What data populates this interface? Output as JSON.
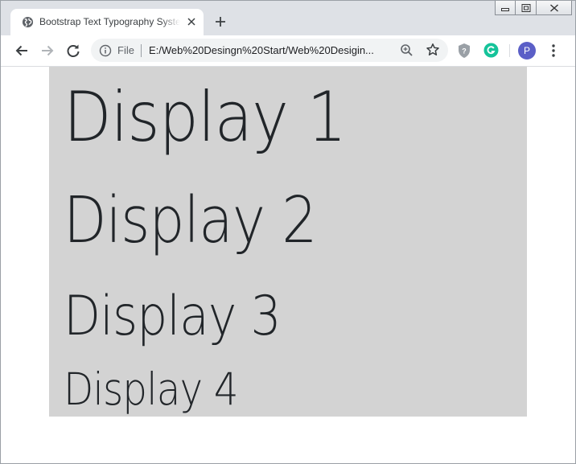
{
  "browser": {
    "tab": {
      "title": "Bootstrap Text Typography System",
      "favicon": "globe-icon"
    },
    "address_bar": {
      "scheme_label": "File",
      "url": "E:/Web%20Desingn%20Start/Web%20Desigin..."
    },
    "profile_initial": "P",
    "icons": {
      "back": "arrow-left-icon",
      "forward": "arrow-right-icon",
      "reload": "reload-icon",
      "info": "info-icon",
      "zoom": "zoom-icon",
      "bookmark": "star-icon",
      "extension_shield": "shield-icon",
      "extension_grammarly": "grammarly-icon",
      "menu": "kebab-menu-icon"
    }
  },
  "page": {
    "background_color": "#d3d3d3",
    "headings": [
      "Display 1",
      "Display 2",
      "Display 3",
      "Display 4"
    ]
  }
}
